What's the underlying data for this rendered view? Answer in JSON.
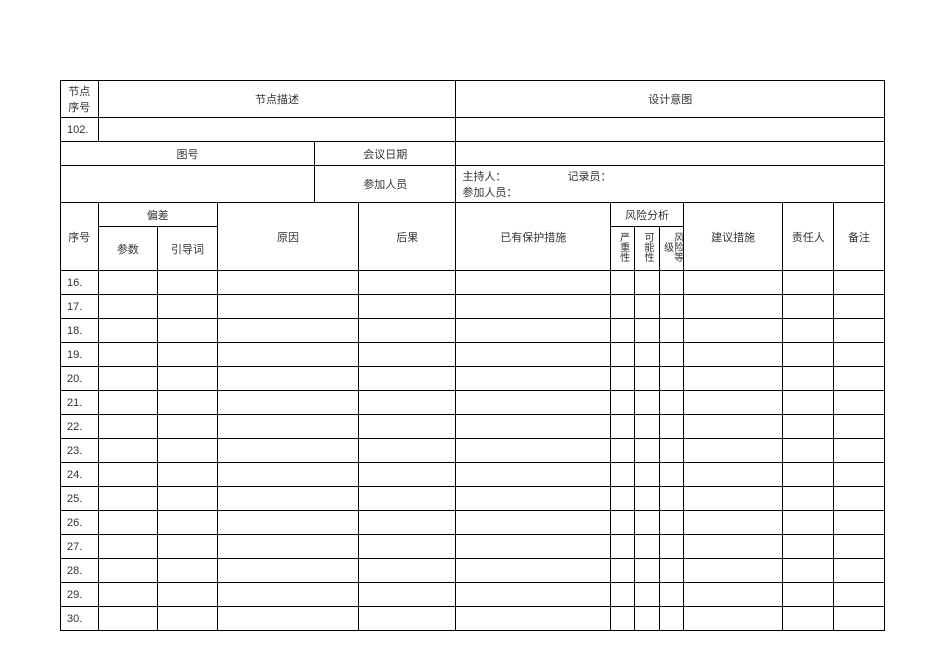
{
  "header": {
    "node_no_label": "节点\n序号",
    "node_desc_label": "节点描述",
    "design_intent_label": "设计意图",
    "node_no_value": "102.",
    "drawing_no_label": "图号",
    "meeting_date_label": "会议日期",
    "participants_label": "参加人员",
    "host_label": "主持人：",
    "recorder_label": "记录员：",
    "participants_line2": "参加人员："
  },
  "columns": {
    "seq": "序号",
    "deviation": "偏差",
    "param": "参数",
    "guideword": "引导词",
    "cause": "原因",
    "consequence": "后果",
    "safeguard": "已有保护措施",
    "risk": "风险分析",
    "severity": "严重性",
    "likelihood": "可能性",
    "risk_level": "风险等级",
    "recommendation": "建议措施",
    "responsible": "责任人",
    "remark": "备注"
  },
  "rows": [
    "16.",
    "17.",
    "18.",
    "19.",
    "20.",
    "21.",
    "22.",
    "23.",
    "24.",
    "25.",
    "26.",
    "27.",
    "28.",
    "29.",
    "30."
  ]
}
